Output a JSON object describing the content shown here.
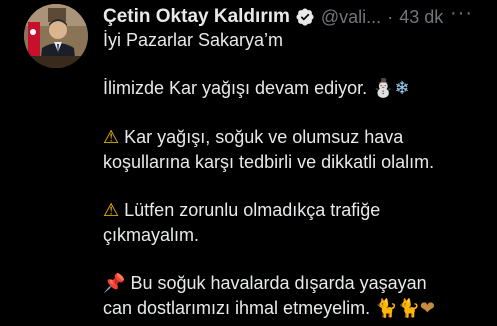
{
  "tweet": {
    "author": {
      "display_name": "Çetin Oktay Kaldırım",
      "handle": "@vali...",
      "verified_icon": "verified-badge-icon",
      "avatar": "author-avatar"
    },
    "separator": "·",
    "timestamp": "43 dk",
    "more_label": "···",
    "text": {
      "line1": "İyi Pazarlar Sakarya’m",
      "line2": "İlimizde Kar yağışı devam ediyor.",
      "line2_emoji": "⛄❄",
      "para2_emoji": "⚠",
      "para2_line1": "Kar yağışı, soğuk ve olumsuz hava",
      "para2_line2": "koşullarına karşı tedbirli ve dikkatli olalım.",
      "para3_emoji": "⚠",
      "para3_line1": "Lütfen zorunlu olmadıkça trafiğe",
      "para3_line2": "çıkmayalım.",
      "para4_emoji": "📌",
      "para4_line1": "Bu soğuk havalarda dışarda yaşayan",
      "para4_line2": "can dostlarımızı ihmal etmeyelim.",
      "para4_end_emoji": "🐈🐈❤"
    },
    "colors": {
      "background": "#000000",
      "text": "#e7e9ea",
      "muted": "#71767b",
      "verified": "#1d9bf0"
    }
  }
}
